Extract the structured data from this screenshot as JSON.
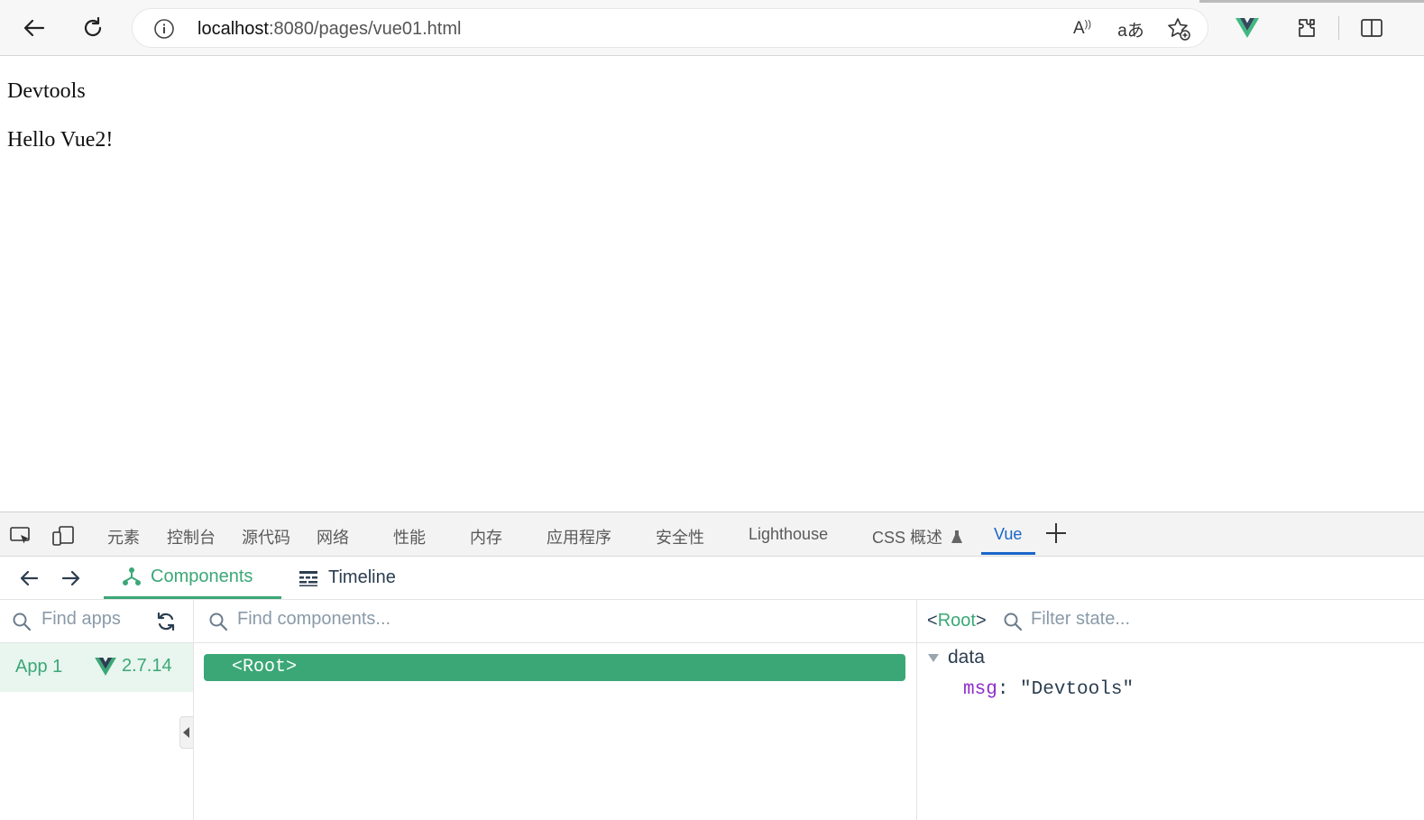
{
  "browser": {
    "url_host": "localhost",
    "url_rest": ":8080/pages/vue01.html",
    "read_aloud_label": "A",
    "translate_label": "aあ"
  },
  "page": {
    "line1": "Devtools",
    "line2": "Hello Vue2!"
  },
  "devtools": {
    "tabs": [
      "元素",
      "控制台",
      "源代码",
      "网络",
      "性能",
      "内存",
      "应用程序",
      "安全性",
      "Lighthouse",
      "CSS 概述",
      "Vue"
    ],
    "active_tab": "Vue",
    "add_tab_label": "+"
  },
  "vue": {
    "nav": {
      "components_label": "Components",
      "timeline_label": "Timeline"
    },
    "apps": {
      "search_placeholder": "Find apps",
      "items": [
        {
          "name": "App 1",
          "version": "2.7.14"
        }
      ]
    },
    "components": {
      "search_placeholder": "Find components...",
      "tree": [
        {
          "label": "<Root>",
          "selected": true
        }
      ]
    },
    "state": {
      "selected_open": "<",
      "selected_name": "Root",
      "selected_close": ">",
      "search_placeholder": "Filter state...",
      "section": "data",
      "props": [
        {
          "key": "msg",
          "sep": ": ",
          "value": "\"Devtools\""
        }
      ]
    },
    "colors": {
      "accent": "#3ba776",
      "text": "#2c3e50",
      "key": "#8f2ec9"
    }
  }
}
